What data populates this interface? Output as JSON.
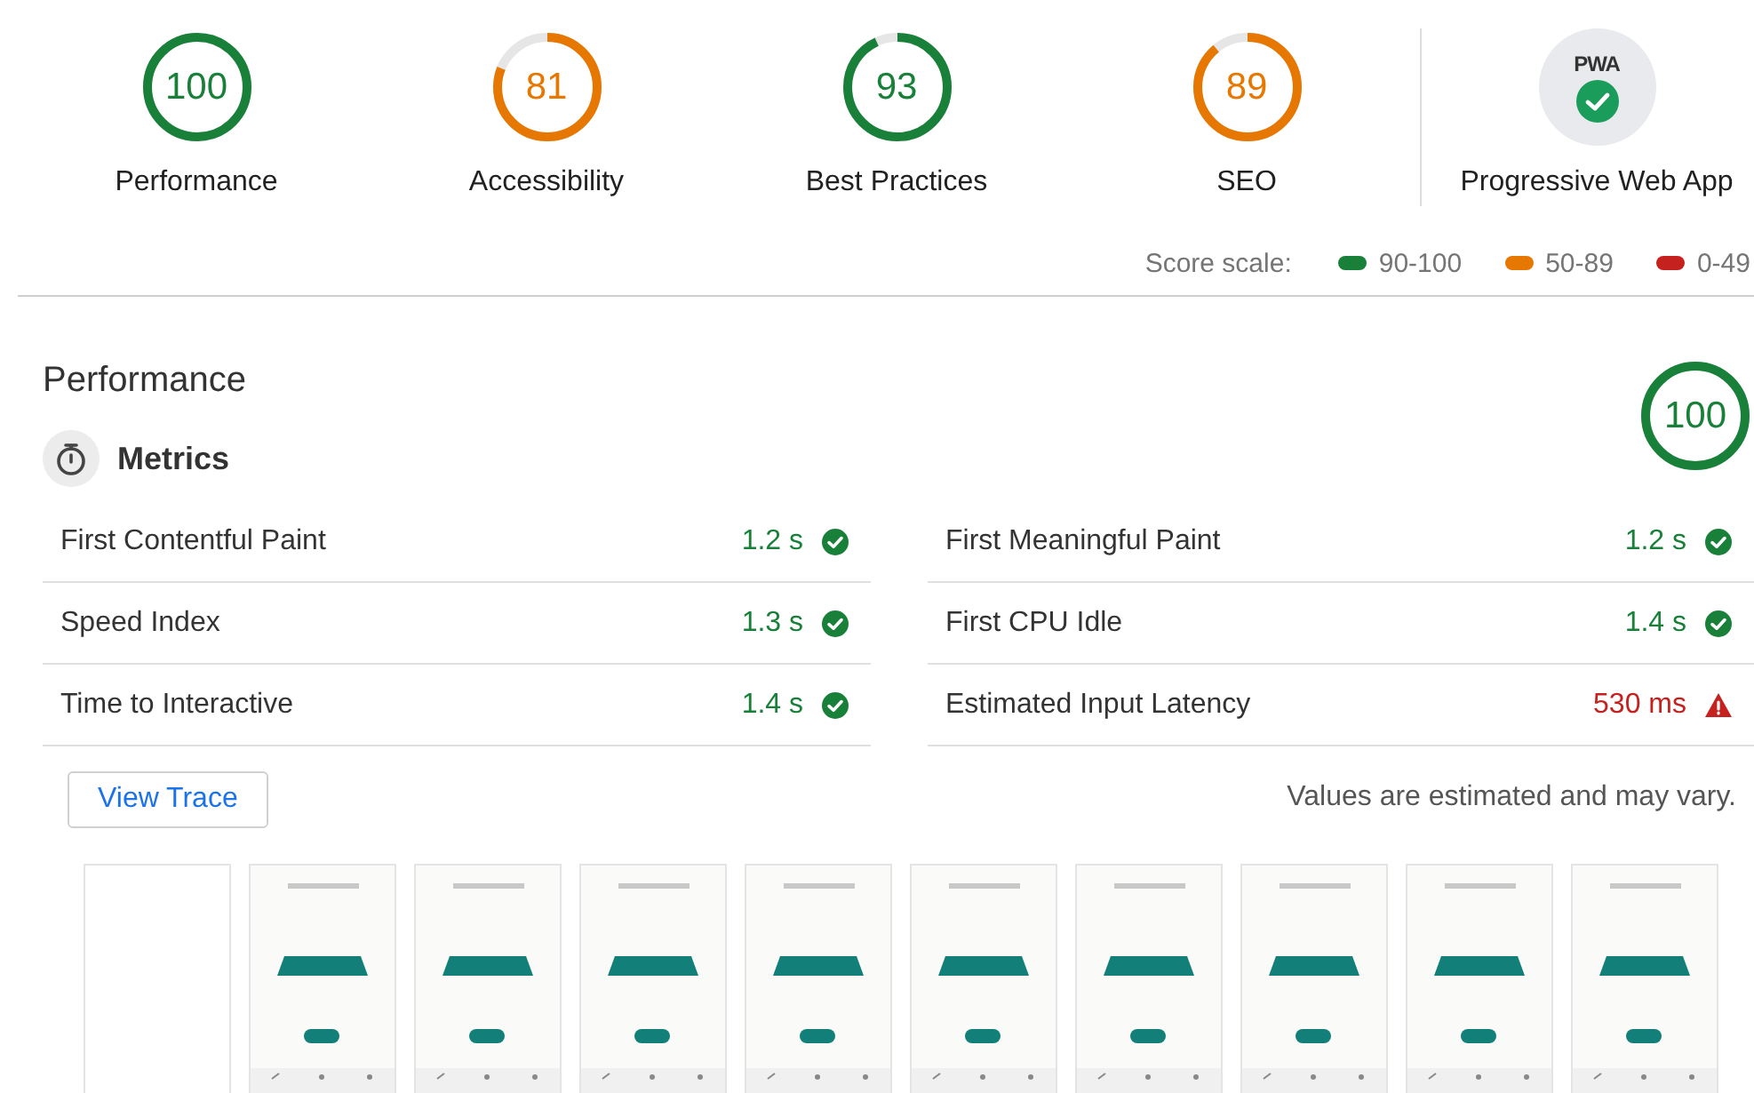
{
  "gauges": [
    {
      "score": "100",
      "label": "Performance",
      "level": 1.0,
      "color": "#188038"
    },
    {
      "score": "81",
      "label": "Accessibility",
      "level": 0.81,
      "color": "#e67700"
    },
    {
      "score": "93",
      "label": "Best Practices",
      "level": 0.93,
      "color": "#188038"
    },
    {
      "score": "89",
      "label": "SEO",
      "level": 0.89,
      "color": "#e67700"
    }
  ],
  "pwa": {
    "badge": "PWA",
    "label": "Progressive Web App"
  },
  "score_scale": {
    "label": "Score scale:",
    "ranges": [
      {
        "label": "90-100",
        "color": "#188038"
      },
      {
        "label": "50-89",
        "color": "#e67700"
      },
      {
        "label": "0-49",
        "color": "#c5221f"
      }
    ]
  },
  "section": {
    "title": "Performance",
    "score": "100",
    "level": 1.0,
    "color": "#188038"
  },
  "metrics": {
    "title": "Metrics",
    "items": [
      {
        "name": "First Contentful Paint",
        "value": "1.2 s",
        "kind": "pass"
      },
      {
        "name": "First Meaningful Paint",
        "value": "1.2 s",
        "kind": "pass"
      },
      {
        "name": "Speed Index",
        "value": "1.3 s",
        "kind": "pass"
      },
      {
        "name": "First CPU Idle",
        "value": "1.4 s",
        "kind": "pass"
      },
      {
        "name": "Time to Interactive",
        "value": "1.4 s",
        "kind": "pass"
      },
      {
        "name": "Estimated Input Latency",
        "value": "530 ms",
        "kind": "fail"
      }
    ]
  },
  "view_trace": "View Trace",
  "note": "Values are estimated and may vary.",
  "filmstrip": [
    {
      "kind": "blank"
    },
    {
      "kind": "app"
    },
    {
      "kind": "app"
    },
    {
      "kind": "app"
    },
    {
      "kind": "app"
    },
    {
      "kind": "app"
    },
    {
      "kind": "app"
    },
    {
      "kind": "app"
    },
    {
      "kind": "app"
    },
    {
      "kind": "app"
    }
  ]
}
